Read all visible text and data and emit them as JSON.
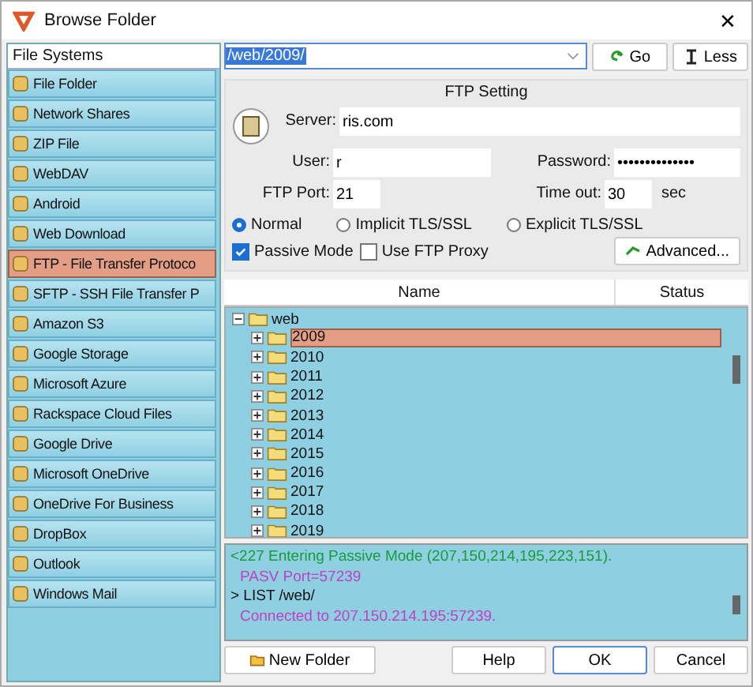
{
  "window": {
    "title": "Browse Folder",
    "close": "✕"
  },
  "sidebar": {
    "header": "File Systems",
    "items": [
      {
        "label": "File Folder",
        "selected": false
      },
      {
        "label": "Network Shares",
        "selected": false
      },
      {
        "label": "ZIP File",
        "selected": false
      },
      {
        "label": "WebDAV",
        "selected": false
      },
      {
        "label": "Android",
        "selected": false
      },
      {
        "label": "Web Download",
        "selected": false
      },
      {
        "label": "FTP - File Transfer Protoco",
        "selected": true
      },
      {
        "label": "SFTP - SSH File Transfer P",
        "selected": false
      },
      {
        "label": "Amazon S3",
        "selected": false
      },
      {
        "label": "Google Storage",
        "selected": false
      },
      {
        "label": "Microsoft Azure",
        "selected": false
      },
      {
        "label": "Rackspace Cloud Files",
        "selected": false
      },
      {
        "label": "Google Drive",
        "selected": false
      },
      {
        "label": "Microsoft OneDrive",
        "selected": false
      },
      {
        "label": "OneDrive For Business",
        "selected": false
      },
      {
        "label": "DropBox",
        "selected": false
      },
      {
        "label": "Outlook",
        "selected": false
      },
      {
        "label": "Windows Mail",
        "selected": false
      }
    ]
  },
  "path": {
    "value": "/web/2009/",
    "go": "Go",
    "less": "Less"
  },
  "ftp": {
    "title": "FTP Setting",
    "server_label": "Server:",
    "server": "ris.com",
    "user_label": "User:",
    "user": "r",
    "password_label": "Password:",
    "password": "••••••••••••••",
    "port_label": "FTP Port:",
    "port": "21",
    "timeout_label": "Time out:",
    "timeout": "30",
    "timeout_unit": "sec",
    "modes": [
      {
        "label": "Normal",
        "selected": true
      },
      {
        "label": "Implicit TLS/SSL",
        "selected": false
      },
      {
        "label": "Explicit TLS/SSL",
        "selected": false
      }
    ],
    "options": [
      {
        "label": "Passive Mode",
        "checked": true
      },
      {
        "label": "Use FTP Proxy",
        "checked": false
      }
    ],
    "advanced": "Advanced..."
  },
  "tree": {
    "columns": [
      "Name",
      "Status"
    ],
    "items": [
      {
        "label": "web",
        "expanded": true,
        "selected": false,
        "children": [
          {
            "label": "2009",
            "expanded": false,
            "selected": true
          },
          {
            "label": "2010",
            "expanded": false,
            "selected": false
          },
          {
            "label": "2011",
            "expanded": false,
            "selected": false
          },
          {
            "label": "2012",
            "expanded": false,
            "selected": false
          },
          {
            "label": "2013",
            "expanded": false,
            "selected": false
          },
          {
            "label": "2014",
            "expanded": false,
            "selected": false
          },
          {
            "label": "2015",
            "expanded": false,
            "selected": false
          },
          {
            "label": "2016",
            "expanded": false,
            "selected": false
          },
          {
            "label": "2017",
            "expanded": false,
            "selected": false
          },
          {
            "label": "2018",
            "expanded": false,
            "selected": false
          },
          {
            "label": "2019",
            "expanded": false,
            "selected": false
          }
        ]
      }
    ]
  },
  "log": [
    {
      "kind": "response",
      "text": "<227 Entering Passive Mode (207,150,214,195,223,151)."
    },
    {
      "kind": "info",
      "text": "PASV Port=57239"
    },
    {
      "kind": "command",
      "text": "> LIST /web/"
    },
    {
      "kind": "info",
      "text": "Connected to 207.150.214.195:57239."
    }
  ],
  "buttons": {
    "new_folder": "New Folder",
    "help": "Help",
    "ok": "OK",
    "cancel": "Cancel"
  }
}
